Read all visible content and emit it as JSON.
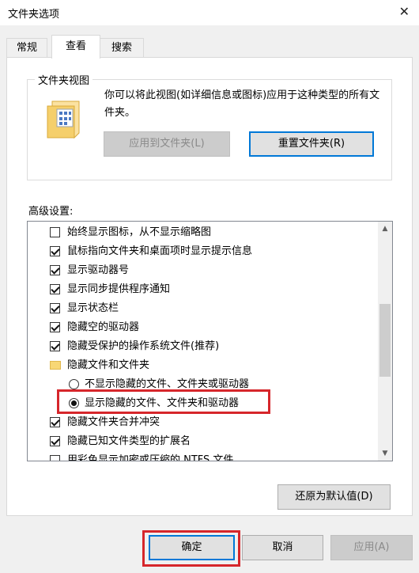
{
  "window": {
    "title": "文件夹选项"
  },
  "tabs": [
    {
      "label": "常规"
    },
    {
      "label": "查看"
    },
    {
      "label": "搜索"
    }
  ],
  "folder_views": {
    "group_label": "文件夹视图",
    "description": "你可以将此视图(如详细信息或图标)应用于这种类型的所有文件夹。",
    "apply_button": "应用到文件夹(L)",
    "reset_button": "重置文件夹(R)"
  },
  "advanced": {
    "label": "高级设置:",
    "items": [
      {
        "type": "checkbox",
        "checked": false,
        "label": "始终显示图标，从不显示缩略图"
      },
      {
        "type": "checkbox",
        "checked": true,
        "label": "鼠标指向文件夹和桌面项时显示提示信息"
      },
      {
        "type": "checkbox",
        "checked": true,
        "label": "显示驱动器号"
      },
      {
        "type": "checkbox",
        "checked": true,
        "label": "显示同步提供程序通知"
      },
      {
        "type": "checkbox",
        "checked": true,
        "label": "显示状态栏"
      },
      {
        "type": "checkbox",
        "checked": true,
        "label": "隐藏空的驱动器"
      },
      {
        "type": "checkbox",
        "checked": true,
        "label": "隐藏受保护的操作系统文件(推荐)"
      },
      {
        "type": "folder",
        "label": "隐藏文件和文件夹"
      },
      {
        "type": "radio",
        "checked": false,
        "label": "不显示隐藏的文件、文件夹或驱动器"
      },
      {
        "type": "radio",
        "checked": true,
        "label": "显示隐藏的文件、文件夹和驱动器"
      },
      {
        "type": "checkbox",
        "checked": true,
        "label": "隐藏文件夹合并冲突"
      },
      {
        "type": "checkbox",
        "checked": true,
        "label": "隐藏已知文件类型的扩展名"
      },
      {
        "type": "checkbox",
        "checked": false,
        "label": "用彩色显示加密或压缩的 NTFS 文件"
      }
    ],
    "restore_button": "还原为默认值(D)"
  },
  "footer": {
    "ok": "确定",
    "cancel": "取消",
    "apply": "应用(A)"
  },
  "icons": {
    "close": "close-icon",
    "scroll_up": "chevron-up-icon",
    "scroll_down": "chevron-down-icon"
  },
  "colors": {
    "highlight": "#d6262b",
    "focus": "#0078d7"
  }
}
